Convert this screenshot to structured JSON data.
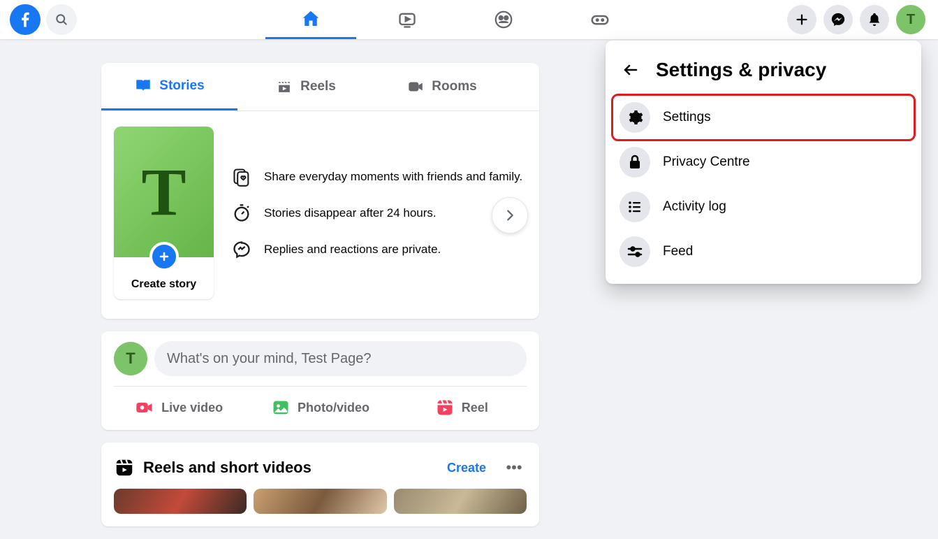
{
  "topbar": {
    "profile_initial": "T"
  },
  "stories": {
    "tabs": {
      "stories": "Stories",
      "reels": "Reels",
      "rooms": "Rooms"
    },
    "create_label": "Create story",
    "create_initial": "T",
    "info": {
      "share": "Share everyday moments with friends and family.",
      "disappear": "Stories disappear after 24 hours.",
      "private": "Replies and reactions are private."
    }
  },
  "composer": {
    "avatar_initial": "T",
    "placeholder": "What's on your mind, Test Page?",
    "actions": {
      "live": "Live video",
      "photo": "Photo/video",
      "reel": "Reel"
    }
  },
  "reels": {
    "title": "Reels and short videos",
    "create": "Create"
  },
  "dropdown": {
    "title": "Settings & privacy",
    "items": {
      "settings": "Settings",
      "privacy": "Privacy Centre",
      "activity": "Activity log",
      "feed": "Feed"
    }
  }
}
